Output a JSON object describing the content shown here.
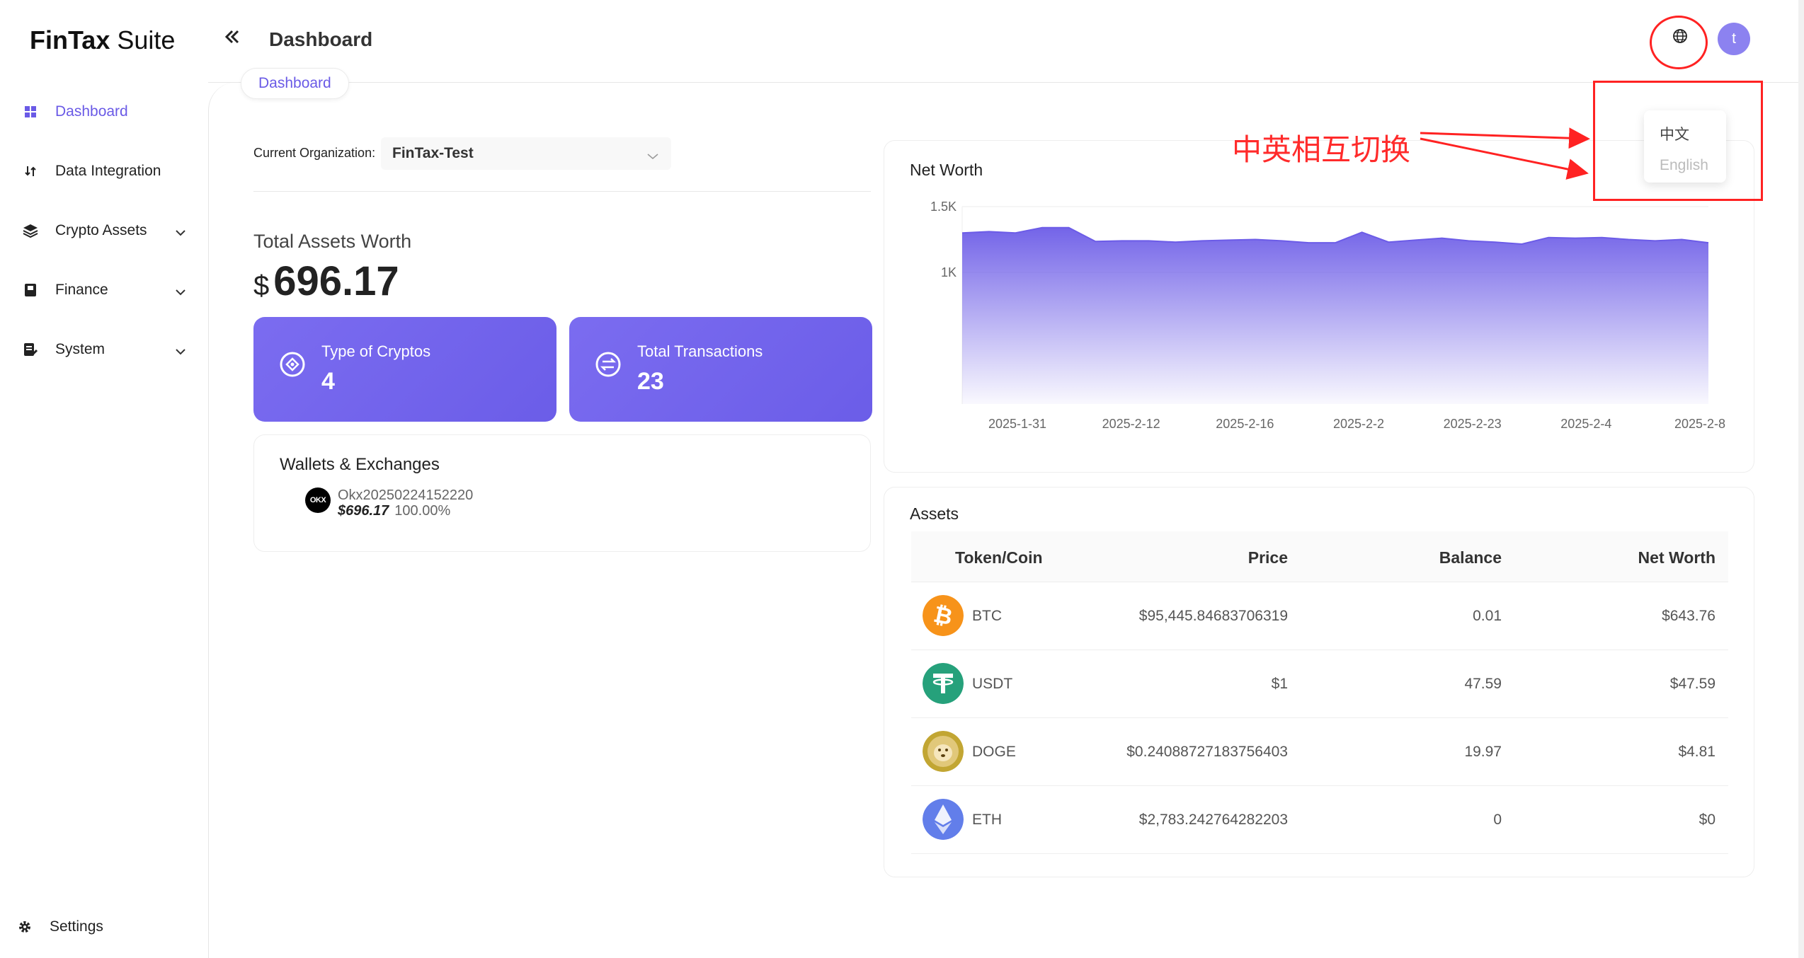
{
  "app": {
    "logo_bold": "FinTax",
    "logo_light": " Suite"
  },
  "sidebar": {
    "items": [
      {
        "label": "Dashboard",
        "icon": "dashboard-icon",
        "active": true
      },
      {
        "label": "Data Integration",
        "icon": "data-integration-icon",
        "active": false
      },
      {
        "label": "Crypto Assets",
        "icon": "layers-icon",
        "active": false,
        "expandable": true
      },
      {
        "label": "Finance",
        "icon": "book-icon",
        "active": false,
        "expandable": true
      },
      {
        "label": "System",
        "icon": "system-icon",
        "active": false,
        "expandable": true
      }
    ],
    "settings_label": "Settings"
  },
  "header": {
    "title": "Dashboard",
    "avatar_letter": "t",
    "tab_label": "Dashboard"
  },
  "org": {
    "label": "Current Organization:",
    "value": "FinTax-Test"
  },
  "summary": {
    "total_label": "Total Assets Worth",
    "currency": "$",
    "total_value": "696.17",
    "types_label": "Type of Cryptos",
    "types_value": "4",
    "tx_label": "Total Transactions",
    "tx_value": "23"
  },
  "wallets": {
    "title": "Wallets & Exchanges",
    "items": [
      {
        "logo": "OKX",
        "name": "Okx20250224152220",
        "amount": "$696.17",
        "percent": "100.00%"
      }
    ]
  },
  "net_worth": {
    "title": "Net Worth"
  },
  "chart_data": {
    "type": "area",
    "title": "Net Worth",
    "xlabel": "",
    "ylabel": "",
    "ylim": [
      0,
      1500
    ],
    "y_ticks": [
      "1.5K",
      "1K"
    ],
    "y_tick_values": [
      1500,
      1000
    ],
    "x_tick_labels": [
      "2025-1-31",
      "2025-2-12",
      "2025-2-16",
      "2025-2-2",
      "2025-2-23",
      "2025-2-4",
      "2025-2-8"
    ],
    "series": [
      {
        "color": "#6c5ce7",
        "values": [
          1300,
          1310,
          1300,
          1340,
          1340,
          1235,
          1240,
          1240,
          1230,
          1240,
          1245,
          1250,
          1240,
          1225,
          1225,
          1305,
          1230,
          1245,
          1260,
          1240,
          1230,
          1215,
          1265,
          1260,
          1265,
          1250,
          1240,
          1250,
          1225
        ]
      }
    ],
    "grid": true
  },
  "assets": {
    "title": "Assets",
    "columns": [
      "Token/Coin",
      "Price",
      "Balance",
      "Net Worth"
    ],
    "rows": [
      {
        "symbol": "BTC",
        "price": "$95,445.84683706319",
        "balance": "0.01",
        "net_worth": "$643.76",
        "color": "#f7931a"
      },
      {
        "symbol": "USDT",
        "price": "$1",
        "balance": "47.59",
        "net_worth": "$47.59",
        "color": "#26a17b"
      },
      {
        "symbol": "DOGE",
        "price": "$0.24088727183756403",
        "balance": "19.97",
        "net_worth": "$4.81",
        "color": "#c2a633"
      },
      {
        "symbol": "ETH",
        "price": "$2,783.242764282203",
        "balance": "0",
        "net_worth": "$0",
        "color": "#627eea"
      }
    ]
  },
  "language_menu": {
    "zh": "中文",
    "en": "English"
  },
  "annotation": {
    "text": "中英相互切换",
    "color": "#ff2222"
  },
  "colors": {
    "accent": "#6a5ae6",
    "card_gradient_start": "#7b6cf0",
    "card_gradient_end": "#6b5de8"
  }
}
